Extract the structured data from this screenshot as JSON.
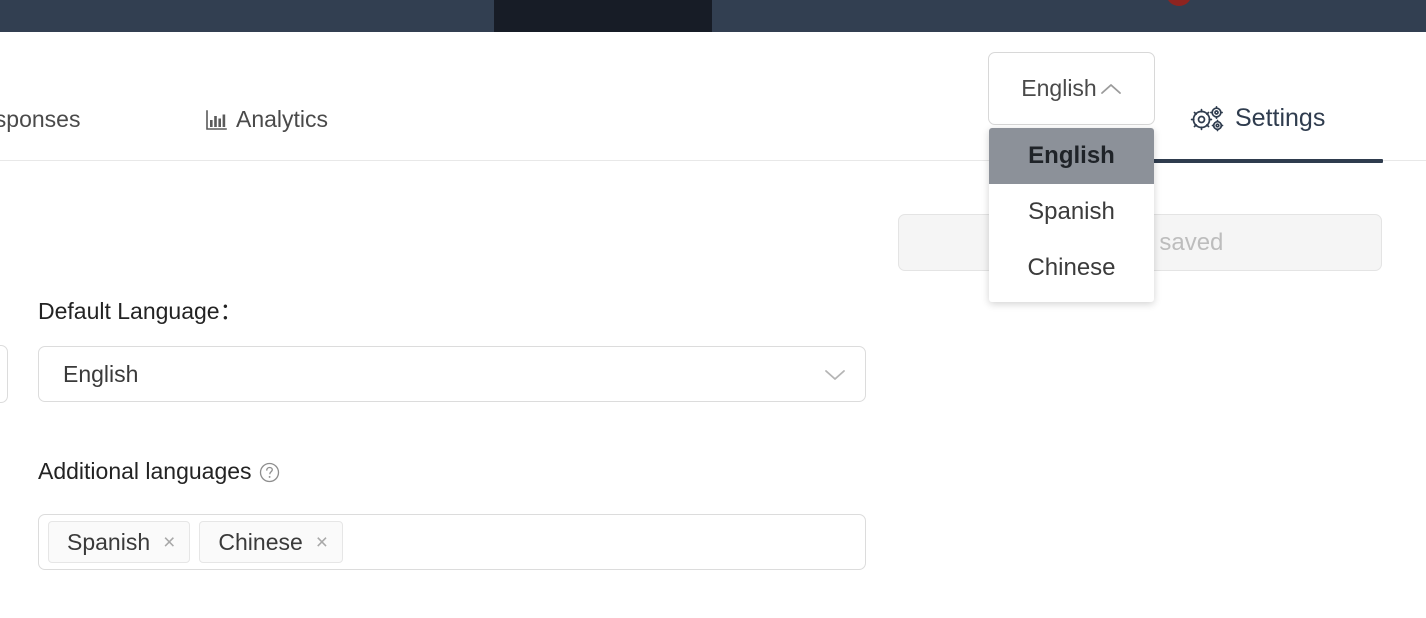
{
  "topbar": {
    "notification_dot_color": "#8e2420",
    "background_color": "#323f51",
    "active_region_color": "#171c26"
  },
  "nav": {
    "tabs": [
      {
        "label": "esponses",
        "icon": "",
        "name": "tab-responses",
        "active": false
      },
      {
        "label": "Analytics",
        "icon": "bar-chart-icon",
        "name": "tab-analytics",
        "active": false
      },
      {
        "label": "Settings",
        "icon": "gears-icon",
        "name": "tab-settings",
        "active": true
      }
    ],
    "active_underline_color": "#2f3c4e"
  },
  "language_switcher": {
    "button_label": "English",
    "chevron_icon": "chevron-up-icon",
    "expanded": true,
    "options": [
      {
        "label": "English",
        "selected": true
      },
      {
        "label": "Spanish",
        "selected": false
      },
      {
        "label": "Chinese",
        "selected": false
      }
    ]
  },
  "banner": {
    "text": "Changes saved",
    "background_color": "#f5f5f5",
    "text_color": "#bdbdbd"
  },
  "form": {
    "default_language": {
      "label": "Default Language：",
      "value": "English",
      "chevron_icon": "chevron-down-icon"
    },
    "additional_languages": {
      "label": "Additional languages",
      "help_icon": "question-circle-icon",
      "tags": [
        {
          "label": "Spanish",
          "remove_glyph": "×"
        },
        {
          "label": "Chinese",
          "remove_glyph": "×"
        }
      ]
    }
  }
}
